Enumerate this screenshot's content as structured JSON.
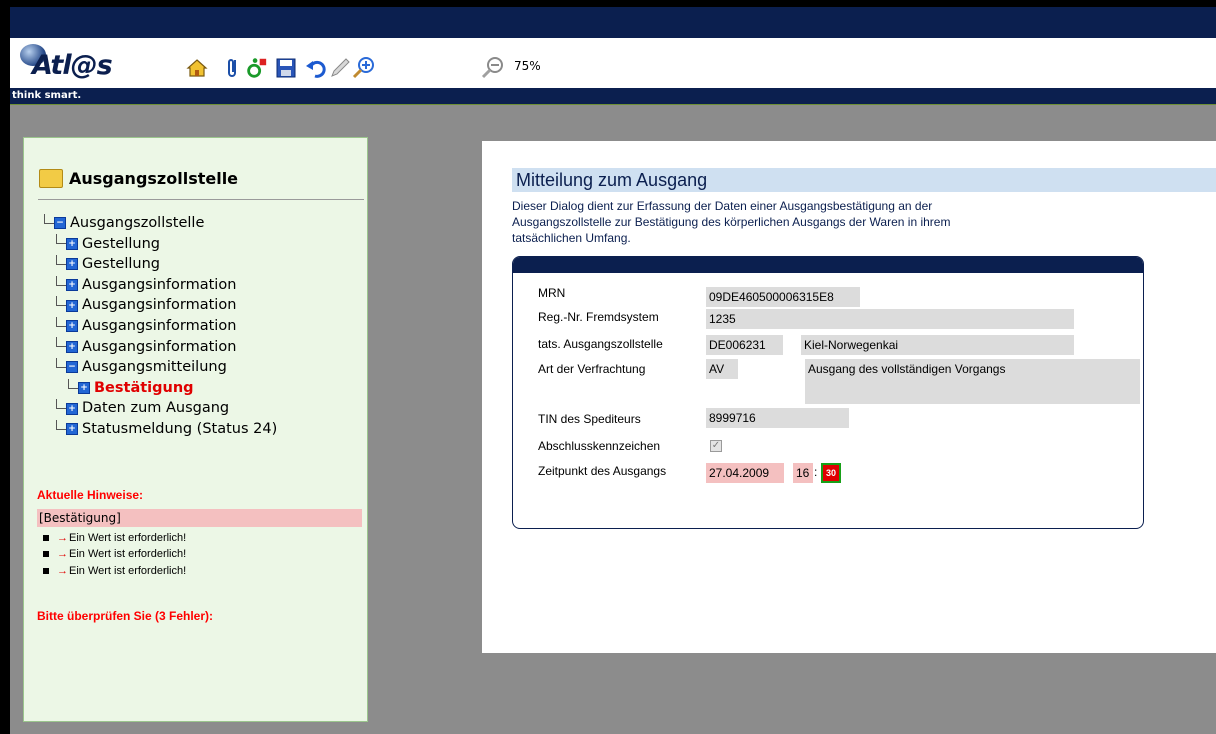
{
  "toolbar": {
    "logo_text": "Atl@s",
    "tagline": "think smart.",
    "zoom_label": "75%",
    "icons": [
      "home-icon",
      "paperclip-icon",
      "accessibility-icon",
      "save-icon",
      "undo-icon",
      "pencil-icon",
      "zoom-in-icon",
      "zoom-out-icon"
    ]
  },
  "sidebar": {
    "title": "Ausgangszollstelle",
    "tree": [
      {
        "label": "Ausgangszollstelle",
        "level": 0,
        "expanded": true
      },
      {
        "label": "Gestellung",
        "level": 1
      },
      {
        "label": "Gestellung",
        "level": 1
      },
      {
        "label": "Ausgangsinformation",
        "level": 1
      },
      {
        "label": "Ausgangsinformation",
        "level": 1
      },
      {
        "label": "Ausgangsinformation",
        "level": 1
      },
      {
        "label": "Ausgangsinformation",
        "level": 1
      },
      {
        "label": "Ausgangsmitteilung",
        "level": 1,
        "expanded": true
      },
      {
        "label": "Bestätigung",
        "level": 2,
        "active": true
      },
      {
        "label": "Daten zum Ausgang",
        "level": 1
      },
      {
        "label": "Statusmeldung (Status 24)",
        "level": 1
      }
    ],
    "hints_title": "Aktuelle Hinweise:",
    "hint_section": "[Bestätigung]",
    "hints": [
      "Ein Wert ist erforderlich!",
      "Ein Wert ist erforderlich!",
      "Ein Wert ist erforderlich!"
    ],
    "check_title": "Bitte überprüfen Sie (3 Fehler):"
  },
  "main": {
    "title": "Mitteilung zum Ausgang",
    "description_lines": [
      "Dieser Dialog dient zur Erfassung der Daten einer Ausgangsbestätigung an der",
      "Ausgangszollstelle zur Bestätigung des körperlichen Ausgangs der Waren in ihrem",
      "tatsächlichen Umfang."
    ],
    "form": {
      "mrn_label": "MRN",
      "mrn_value": "09DE460500006315E8",
      "reg_label": "Reg.-Nr. Fremdsystem",
      "reg_value": "1235",
      "zollstelle_label": "tats. Ausgangszollstelle",
      "zollstelle_code": "DE006231",
      "zollstelle_name": "Kiel-Norwegenkai",
      "verfrachtung_label": "Art der Verfrachtung",
      "verfrachtung_code": "AV",
      "verfrachtung_text": "Ausgang des vollständigen Vorgangs",
      "tin_label": "TIN des Spediteurs",
      "tin_value": "8999716",
      "abschluss_label": "Abschlusskennzeichen",
      "abschluss_checked": true,
      "zeitpunkt_label": "Zeitpunkt des Ausgangs",
      "date_value": "27.04.2009",
      "hour_value": "16",
      "time_separator": ":",
      "minute_value": "30"
    }
  },
  "colors": {
    "navy": "#0b1f4f",
    "sidebar_bg": "#ecf7e6",
    "error_red": "#ff0000",
    "required_field": "#f4c0c0",
    "title_band": "#cfe0f1"
  }
}
